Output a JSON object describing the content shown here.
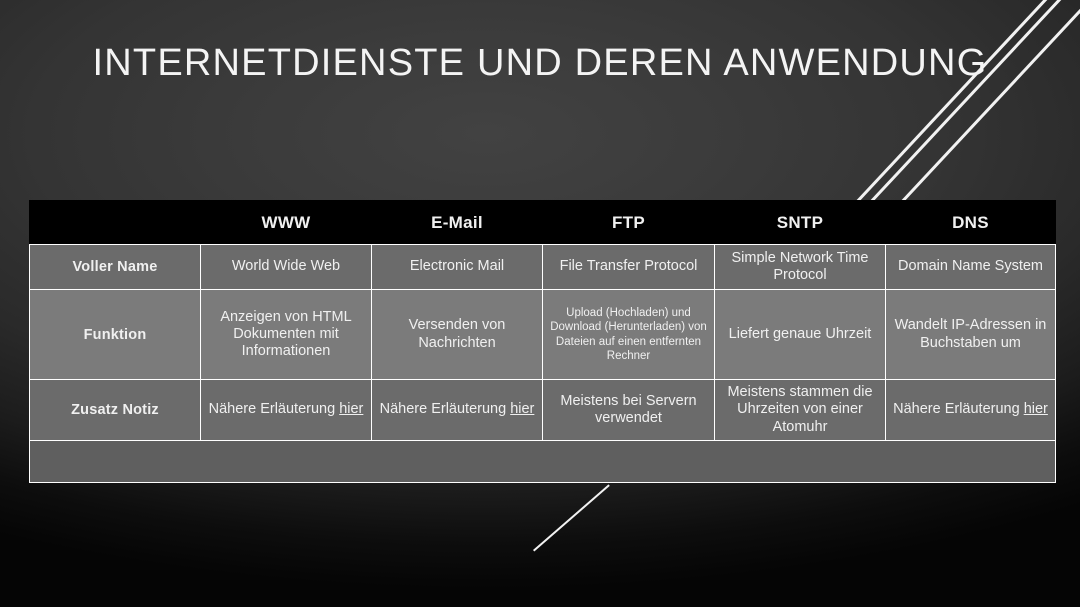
{
  "slide": {
    "title": "INTERNETDIENSTE UND DEREN ANWENDUNG",
    "colors": {
      "background_light": "#424242",
      "background_dark": "#050505",
      "header_row": "#000000",
      "row_normal": "#6b6b6b",
      "row_highlight": "#7b7b7b",
      "row_empty": "#5f5f5f",
      "border": "#ffffff",
      "text": "#f0f0f0"
    }
  },
  "table": {
    "corner_label": "",
    "columns": [
      "WWW",
      "E-Mail",
      "FTP",
      "SNTP",
      "DNS"
    ],
    "rows": [
      {
        "label": "Voller Name",
        "cells": [
          "World Wide Web",
          "Electronic Mail",
          "File Transfer Protocol",
          "Simple Network Time Protocol",
          "Domain Name System"
        ]
      },
      {
        "label": "Funktion",
        "cells": [
          "Anzeigen von HTML Dokumenten mit Informationen",
          "Versenden von Nachrichten",
          "Upload (Hochladen) und Download (Herunterladen) von Dateien auf einen entfernten Rechner",
          "Liefert genaue Uhrzeit",
          "Wandelt IP-Adressen in Buchstaben um"
        ]
      },
      {
        "label": "Zusatz Notiz",
        "cells": [
          {
            "text": "Nähere Erläuterung ",
            "link": "hier"
          },
          {
            "text": "Nähere Erläuterung ",
            "link": "hier"
          },
          {
            "text": "Meistens bei Servern verwendet",
            "link": ""
          },
          {
            "text": "Meistens stammen die Uhrzeiten von einer Atomuhr",
            "link": ""
          },
          {
            "text": "Nähere Erläuterung ",
            "link": "hier"
          }
        ]
      }
    ]
  }
}
